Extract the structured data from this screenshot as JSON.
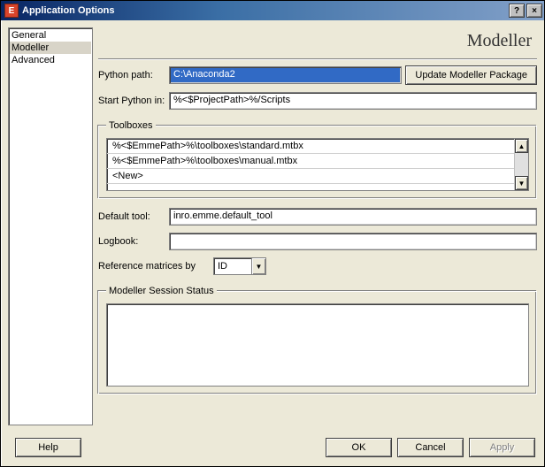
{
  "window": {
    "icon_letter": "E",
    "title": "Application Options",
    "help_glyph": "?",
    "close_glyph": "×"
  },
  "sidebar": {
    "items": [
      {
        "label": "General",
        "selected": false
      },
      {
        "label": "Modeller",
        "selected": true
      },
      {
        "label": "Advanced",
        "selected": false
      }
    ]
  },
  "main": {
    "heading": "Modeller",
    "python_path": {
      "label": "Python path:",
      "value": "C:\\Anaconda2"
    },
    "update_button": "Update Modeller Package",
    "start_python": {
      "label": "Start Python in:",
      "value": "%<$ProjectPath>%/Scripts"
    },
    "toolboxes": {
      "legend": "Toolboxes",
      "rows": [
        "%<$EmmePath>%\\toolboxes\\standard.mtbx",
        "%<$EmmePath>%\\toolboxes\\manual.mtbx",
        "<New>"
      ]
    },
    "default_tool": {
      "label": "Default tool:",
      "value": "inro.emme.default_tool"
    },
    "logbook": {
      "label": "Logbook:",
      "value": ""
    },
    "ref_matrices": {
      "label": "Reference matrices by",
      "value": "ID"
    },
    "session": {
      "legend": "Modeller Session Status",
      "content": ""
    }
  },
  "footer": {
    "help": "Help",
    "ok": "OK",
    "cancel": "Cancel",
    "apply": "Apply"
  }
}
